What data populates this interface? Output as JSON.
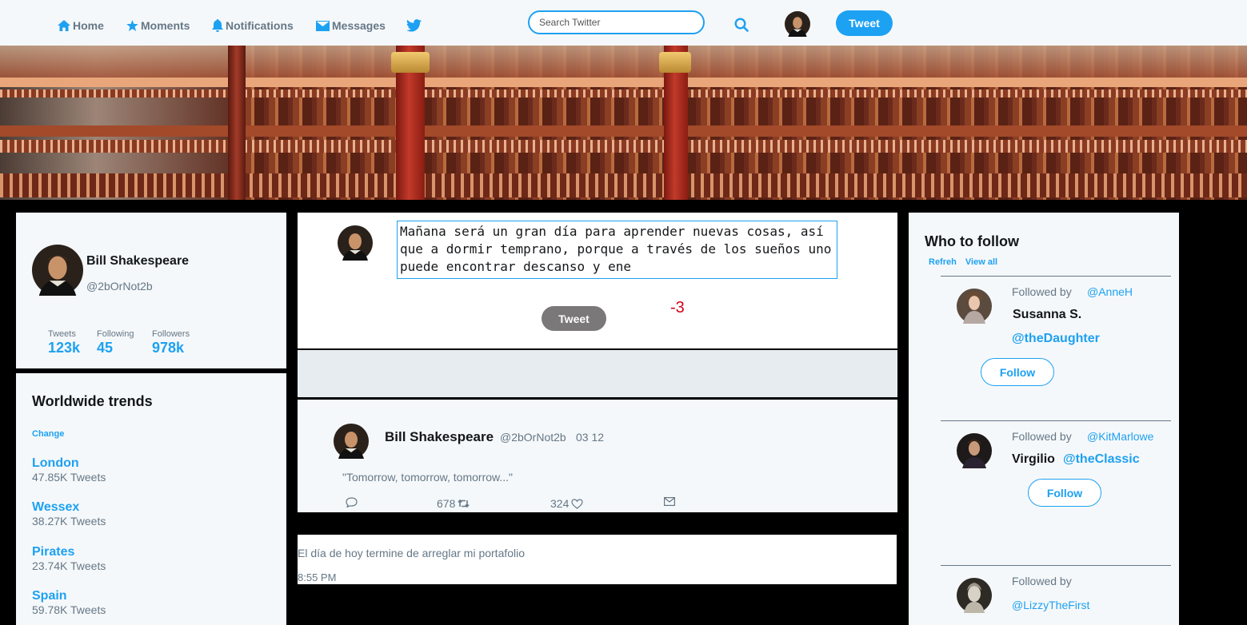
{
  "nav": {
    "items": [
      {
        "label": "Home",
        "icon": "home-icon"
      },
      {
        "label": "Moments",
        "icon": "star-icon"
      },
      {
        "label": "Notifications",
        "icon": "bell-icon"
      },
      {
        "label": "Messages",
        "icon": "envelope-icon"
      }
    ],
    "search_placeholder": "Search Twitter",
    "tweet_label": "Tweet"
  },
  "colors": {
    "accent": "#1da1f2",
    "muted": "#657786",
    "counter": "#d0021b"
  },
  "profile": {
    "name": "Bill Shakespeare",
    "handle": "@2bOrNot2b",
    "stats": [
      {
        "label": "Tweets",
        "value": "123k"
      },
      {
        "label": "Following",
        "value": "45"
      },
      {
        "label": "Followers",
        "value": "978k"
      }
    ]
  },
  "trends": {
    "title": "Worldwide trends",
    "change_label": "Change",
    "items": [
      {
        "name": "London",
        "count": "47.85K Tweets"
      },
      {
        "name": "Wessex",
        "count": "38.27K Tweets"
      },
      {
        "name": "Pirates",
        "count": "23.74K Tweets"
      },
      {
        "name": "Spain",
        "count": "59.78K Tweets"
      }
    ]
  },
  "compose": {
    "text": "Mañana será un gran día para aprender nuevas cosas, así que a dormir temprano, porque a través de los sueños uno puede encontrar descanso y ene",
    "button_label": "Tweet",
    "counter": "-3"
  },
  "tweet": {
    "name": "Bill Shakespeare",
    "handle": "@2bOrNot2b",
    "date": "03 12",
    "text": "\"Tomorrow, tomorrow, tomorrow...\"",
    "retweets": "678",
    "likes": "324"
  },
  "note": {
    "text": "El día de hoy termine de arreglar mi portafolio",
    "time": "8:55 PM"
  },
  "who_to_follow": {
    "title": "Who to follow",
    "refresh_label": "Refreh",
    "view_all_label": "View all",
    "followed_by_label": "Followed by",
    "follow_label": "Follow",
    "items": [
      {
        "by": "@AnneH",
        "name": "Susanna S.",
        "handle": "@theDaughter"
      },
      {
        "by": "@KitMarlowe",
        "name": "Virgilio",
        "handle": "@theClassic"
      },
      {
        "by": "",
        "name": "",
        "handle": "@LizzyTheFirst"
      }
    ]
  }
}
